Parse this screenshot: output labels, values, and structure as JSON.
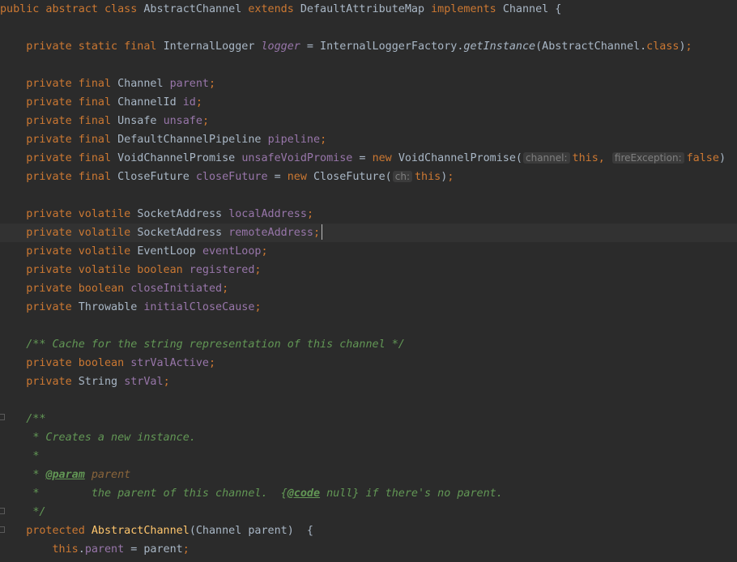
{
  "editor": {
    "language": "java",
    "theme": "darcula",
    "colors": {
      "background": "#2b2b2b",
      "current_line": "#323232",
      "keyword": "#cc7832",
      "field": "#9876aa",
      "method_declaration": "#ffc66d",
      "javadoc": "#629755",
      "parameter_hint_bg": "#3b3b3b"
    },
    "current_line_index": 12,
    "lines": [
      [
        [
          "kw",
          "public abstract class "
        ],
        [
          "id",
          "AbstractChannel "
        ],
        [
          "kw",
          "extends "
        ],
        [
          "id",
          "DefaultAttributeMap "
        ],
        [
          "kw",
          "implements "
        ],
        [
          "id",
          "Channel {"
        ]
      ],
      [],
      [
        [
          "id",
          "    "
        ],
        [
          "kw",
          "private static final "
        ],
        [
          "id",
          "InternalLogger "
        ],
        [
          "ifld",
          "logger"
        ],
        [
          "id",
          " = InternalLoggerFactory."
        ],
        [
          "smi",
          "getInstance"
        ],
        [
          "id",
          "(AbstractChannel."
        ],
        [
          "kw",
          "class"
        ],
        [
          "id",
          ")"
        ],
        [
          "semi",
          ";"
        ]
      ],
      [],
      [
        [
          "id",
          "    "
        ],
        [
          "kw",
          "private final "
        ],
        [
          "id",
          "Channel "
        ],
        [
          "fld",
          "parent"
        ],
        [
          "semi",
          ";"
        ]
      ],
      [
        [
          "id",
          "    "
        ],
        [
          "kw",
          "private final "
        ],
        [
          "id",
          "ChannelId "
        ],
        [
          "fld",
          "id"
        ],
        [
          "semi",
          ";"
        ]
      ],
      [
        [
          "id",
          "    "
        ],
        [
          "kw",
          "private final "
        ],
        [
          "id",
          "Unsafe "
        ],
        [
          "fld",
          "unsafe"
        ],
        [
          "semi",
          ";"
        ]
      ],
      [
        [
          "id",
          "    "
        ],
        [
          "kw",
          "private final "
        ],
        [
          "id",
          "DefaultChannelPipeline "
        ],
        [
          "fld",
          "pipeline"
        ],
        [
          "semi",
          ";"
        ]
      ],
      [
        [
          "id",
          "    "
        ],
        [
          "kw",
          "private final "
        ],
        [
          "id",
          "VoidChannelPromise "
        ],
        [
          "fld",
          "unsafeVoidPromise"
        ],
        [
          "id",
          " = "
        ],
        [
          "kw",
          "new "
        ],
        [
          "id",
          "VoidChannelPromise("
        ],
        [
          "hint",
          "channel:"
        ],
        [
          "kw",
          "this, "
        ],
        [
          "hint",
          "fireException:"
        ],
        [
          "kw",
          "false"
        ],
        [
          "id",
          ")"
        ]
      ],
      [
        [
          "id",
          "    "
        ],
        [
          "kw",
          "private final "
        ],
        [
          "id",
          "CloseFuture "
        ],
        [
          "fld",
          "closeFuture"
        ],
        [
          "id",
          " = "
        ],
        [
          "kw",
          "new "
        ],
        [
          "id",
          "CloseFuture("
        ],
        [
          "hint",
          "ch:"
        ],
        [
          "kw",
          "this"
        ],
        [
          "id",
          ")"
        ],
        [
          "semi",
          ";"
        ]
      ],
      [],
      [
        [
          "id",
          "    "
        ],
        [
          "kw",
          "private volatile "
        ],
        [
          "id",
          "SocketAddress "
        ],
        [
          "fld",
          "localAddress"
        ],
        [
          "semi",
          ";"
        ]
      ],
      [
        [
          "id",
          "    "
        ],
        [
          "kw",
          "private volatile "
        ],
        [
          "id",
          "SocketAddress "
        ],
        [
          "fld",
          "remoteAddress"
        ],
        [
          "semi",
          ";"
        ]
      ],
      [
        [
          "id",
          "    "
        ],
        [
          "kw",
          "private volatile "
        ],
        [
          "id",
          "EventLoop "
        ],
        [
          "fld",
          "eventLoop"
        ],
        [
          "semi",
          ";"
        ]
      ],
      [
        [
          "id",
          "    "
        ],
        [
          "kw",
          "private volatile boolean "
        ],
        [
          "fld",
          "registered"
        ],
        [
          "semi",
          ";"
        ]
      ],
      [
        [
          "id",
          "    "
        ],
        [
          "kw",
          "private boolean "
        ],
        [
          "fld",
          "closeInitiated"
        ],
        [
          "semi",
          ";"
        ]
      ],
      [
        [
          "id",
          "    "
        ],
        [
          "kw",
          "private "
        ],
        [
          "id",
          "Throwable "
        ],
        [
          "fld",
          "initialCloseCause"
        ],
        [
          "semi",
          ";"
        ]
      ],
      [],
      [
        [
          "id",
          "    "
        ],
        [
          "doc",
          "/** Cache for the string representation of this channel */"
        ]
      ],
      [
        [
          "id",
          "    "
        ],
        [
          "kw",
          "private boolean "
        ],
        [
          "fld",
          "strValActive"
        ],
        [
          "semi",
          ";"
        ]
      ],
      [
        [
          "id",
          "    "
        ],
        [
          "kw",
          "private "
        ],
        [
          "id",
          "String "
        ],
        [
          "fld",
          "strVal"
        ],
        [
          "semi",
          ";"
        ]
      ],
      [],
      [
        [
          "id",
          "    "
        ],
        [
          "doc",
          "/**"
        ]
      ],
      [
        [
          "id",
          "     "
        ],
        [
          "doc",
          "* Creates a new instance."
        ]
      ],
      [
        [
          "id",
          "     "
        ],
        [
          "doc",
          "*"
        ]
      ],
      [
        [
          "id",
          "     "
        ],
        [
          "doc",
          "* "
        ],
        [
          "tag",
          "@param"
        ],
        [
          "doc",
          " "
        ],
        [
          "tagv",
          "parent"
        ]
      ],
      [
        [
          "id",
          "     "
        ],
        [
          "doc",
          "*        the parent of this channel.  {"
        ],
        [
          "tag",
          "@code"
        ],
        [
          "doc",
          " null} if there's no parent."
        ]
      ],
      [
        [
          "id",
          "     "
        ],
        [
          "doc",
          "*/"
        ]
      ],
      [
        [
          "id",
          "    "
        ],
        [
          "kw",
          "protected "
        ],
        [
          "cls",
          "AbstractChannel"
        ],
        [
          "id",
          "(Channel parent)  {"
        ]
      ],
      [
        [
          "id",
          "        "
        ],
        [
          "kw",
          "this"
        ],
        [
          "id",
          "."
        ],
        [
          "fld",
          "parent"
        ],
        [
          "id",
          " = parent"
        ],
        [
          "semi",
          ";"
        ]
      ]
    ]
  }
}
